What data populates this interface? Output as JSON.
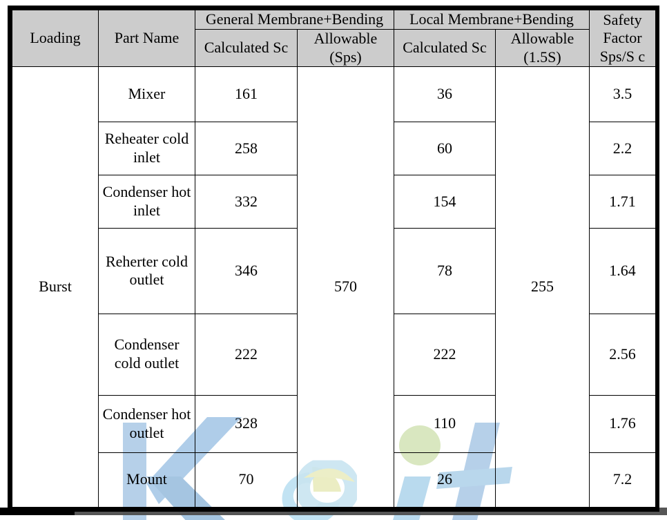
{
  "table": {
    "header": {
      "loading": "Loading",
      "part_name": "Part Name",
      "general_group": "General Membrane+Bending",
      "local_group": "Local Membrane+Bending",
      "general_calculated": "Calculated Sc",
      "general_allowable": "Allowable (Sps)",
      "local_calculated": "Calculated Sc",
      "local_allowable": "Allowable (1.5S)",
      "safety_factor": "Safety Factor Sps/S c"
    },
    "loading_label": "Burst",
    "general_allowable_value": "570",
    "local_allowable_value": "255",
    "rows": [
      {
        "part_name": "Mixer",
        "general_calculated": "161",
        "local_calculated": "36",
        "safety_factor": "3.5"
      },
      {
        "part_name": "Reheater cold inlet",
        "general_calculated": "258",
        "local_calculated": "60",
        "safety_factor": "2.2"
      },
      {
        "part_name": "Condenser hot inlet",
        "general_calculated": "332",
        "local_calculated": "154",
        "safety_factor": "1.71"
      },
      {
        "part_name": "Reherter cold outlet",
        "general_calculated": "346",
        "local_calculated": "78",
        "safety_factor": "1.64"
      },
      {
        "part_name": "Condenser cold outlet",
        "general_calculated": "222",
        "local_calculated": "222",
        "safety_factor": "2.56"
      },
      {
        "part_name": "Condenser hot outlet",
        "general_calculated": "328",
        "local_calculated": "110",
        "safety_factor": "1.76"
      },
      {
        "part_name": "Mount",
        "general_calculated": "70",
        "local_calculated": "26",
        "safety_factor": "7.2"
      }
    ]
  },
  "watermark": {
    "text": "Keit",
    "tile_text": "KEIT",
    "colors": {
      "blue": "#8ab4dd",
      "light_blue": "#9ed3ec",
      "green": "#c2d99a",
      "yellow": "#e4e6a8",
      "bar": "#4d4d4d"
    }
  },
  "colors": {
    "header_background": "#cccccc",
    "border": "#000000",
    "text": "#000000",
    "page_background": "#ffffff"
  }
}
